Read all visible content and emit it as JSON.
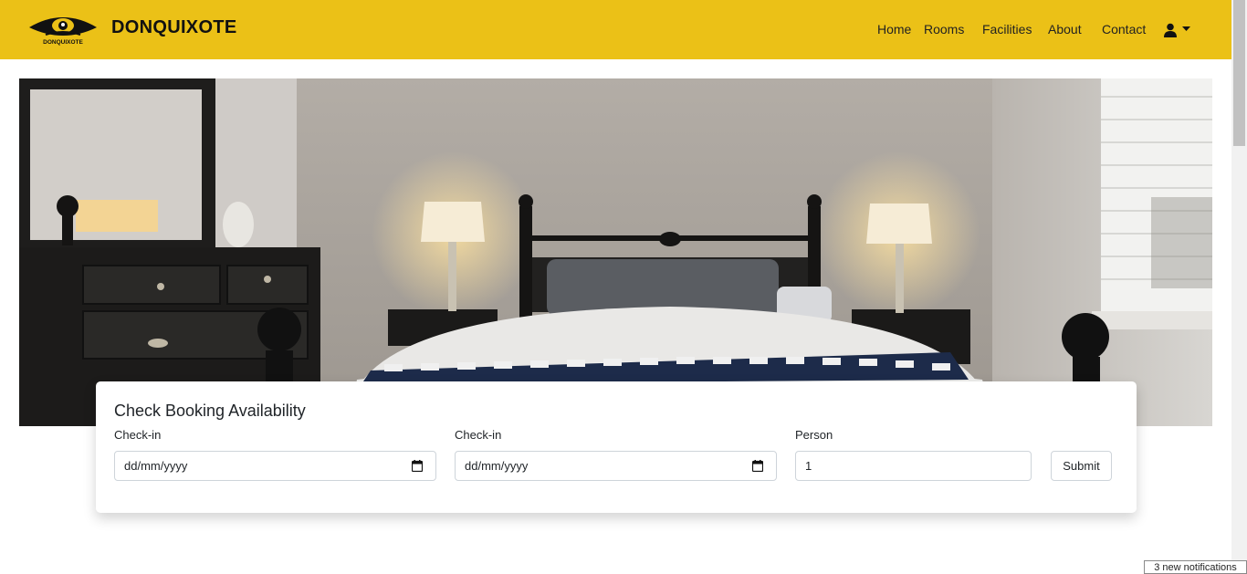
{
  "brand": {
    "name": "DONQUIXOTE",
    "logo_text": "DONQUIXOTE"
  },
  "nav": {
    "items": [
      {
        "label": "Home"
      },
      {
        "label": "Rooms"
      },
      {
        "label": "Facilities"
      },
      {
        "label": "About"
      },
      {
        "label": "Contact"
      }
    ],
    "user_icon": "user-icon",
    "caret_icon": "caret-down-icon"
  },
  "hero": {
    "image": "bedroom-photo"
  },
  "booking": {
    "title": "Check Booking Availability",
    "checkin_label": "Check-in",
    "checkin_value": "dd/mm/yyyy",
    "checkout_label": "Check-in",
    "checkout_value": "dd/mm/yyyy",
    "person_label": "Person",
    "person_value": "1",
    "submit_label": "Submit"
  },
  "notification": {
    "text": "3 new notifications"
  },
  "colors": {
    "navbar": "#ebc117",
    "text": "#212529",
    "border": "#ced4da"
  }
}
